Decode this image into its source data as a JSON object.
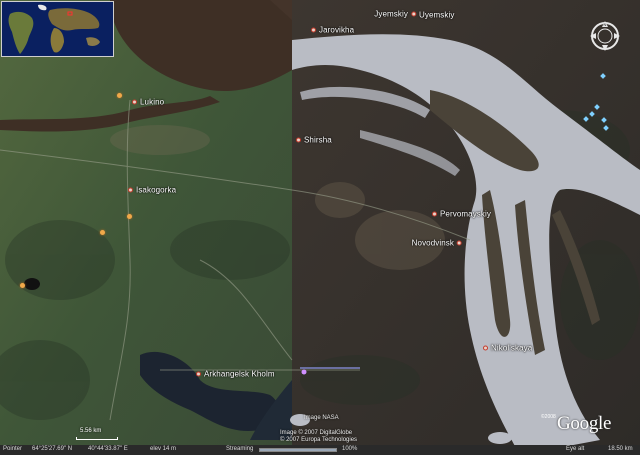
{
  "places": [
    {
      "id": "jarovikha",
      "label": "Jarovikha"
    },
    {
      "id": "jyemskiy",
      "label": "Jyemskiy"
    },
    {
      "id": "uyemskiy",
      "label": "Uyemskiy"
    },
    {
      "id": "lukino",
      "label": "Lukino"
    },
    {
      "id": "shirsha",
      "label": "Shirsha"
    },
    {
      "id": "isakogorka",
      "label": "Isakogorka"
    },
    {
      "id": "pervomayskiy",
      "label": "Pervomayskiy"
    },
    {
      "id": "novodvinsk",
      "label": "Novodvinsk"
    },
    {
      "id": "nikolskaya",
      "label": "Nikol'skaya"
    },
    {
      "id": "arkhangelsk-kholm",
      "label": "Arkhangelsk Kholm"
    }
  ],
  "credits": {
    "image_nasa": "Image NASA",
    "digital_globe": "Image © 2007 DigitalGlobe",
    "europa": "© 2007 Europa Technologies",
    "google_copyright": "©2008",
    "google_logo": "Google"
  },
  "scale": {
    "label": "5.56 km"
  },
  "status": {
    "pointer": "Pointer",
    "lat": "64°25'27.69\" N",
    "lon": "40°44'33.87\" E",
    "elev": "elev    14 m",
    "streaming": "Streaming",
    "streaming_percent": "100%",
    "eye_alt": "Eye alt",
    "eye_alt_value": "18.50 km",
    "streaming_progress": 1.0
  },
  "colors": {
    "river": "#b9bcc4",
    "land_dark": "#3a3630",
    "land_green": "#4a5e3c",
    "place_dot": "#c43b2c",
    "poi": "#f0a94a"
  },
  "compass": {
    "north_label": "N"
  }
}
